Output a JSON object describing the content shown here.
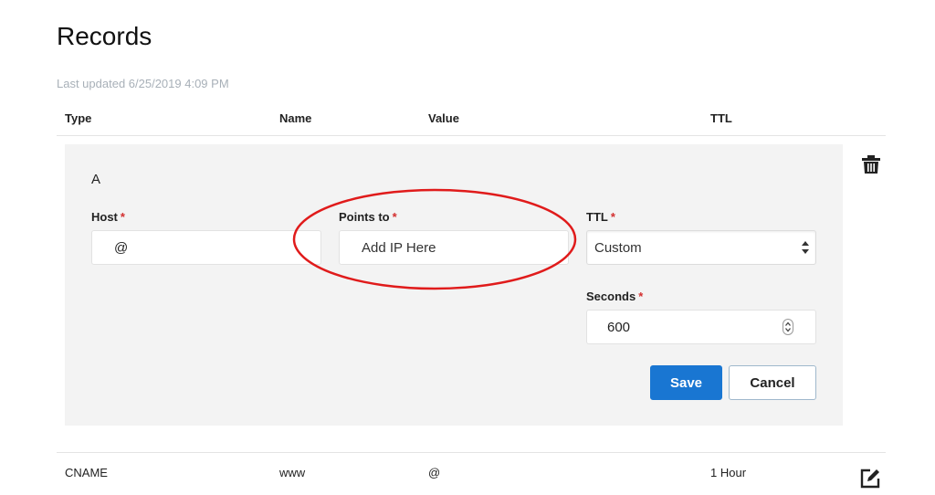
{
  "page": {
    "title": "Records",
    "last_updated": "Last updated 6/25/2019 4:09 PM"
  },
  "table": {
    "headers": [
      "Type",
      "Name",
      "Value",
      "TTL"
    ]
  },
  "edit_form": {
    "record_type": "A",
    "host": {
      "label": "Host",
      "required_mark": "*",
      "value": "@"
    },
    "points_to": {
      "label": "Points to",
      "required_mark": "*",
      "placeholder": "Add IP Here"
    },
    "ttl": {
      "label": "TTL",
      "required_mark": "*",
      "selected": "Custom"
    },
    "seconds": {
      "label": "Seconds",
      "required_mark": "*",
      "value": "600"
    },
    "save_label": "Save",
    "cancel_label": "Cancel"
  },
  "records": [
    {
      "type": "CNAME",
      "name": "www",
      "value": "@",
      "ttl": "1 Hour"
    }
  ],
  "icons": {
    "delete": "trash-icon",
    "edit": "edit-icon"
  },
  "colors": {
    "primary": "#1976d2",
    "required": "#d32f2f",
    "annotation": "#e01b1b",
    "panel_bg": "#f3f3f3"
  }
}
